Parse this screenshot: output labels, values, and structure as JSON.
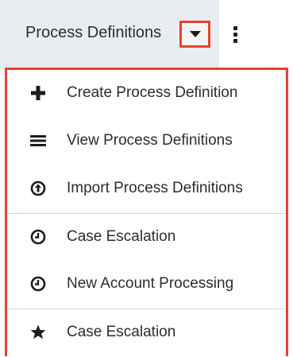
{
  "header": {
    "tab_label": "Process Definitions",
    "caret_icon": "caret-down-icon",
    "more_icon": "vertical-ellipsis-icon"
  },
  "dropdown": {
    "items": [
      {
        "label": "Create Process Definition",
        "icon": "plus-icon"
      },
      {
        "label": "View Process Definitions",
        "icon": "list-icon"
      },
      {
        "label": "Import Process Definitions",
        "icon": "upload-circle-icon"
      },
      {
        "label": "Case Escalation",
        "icon": "clock-icon"
      },
      {
        "label": "New Account Processing",
        "icon": "clock-icon"
      },
      {
        "label": "Case Escalation",
        "icon": "star-icon"
      }
    ]
  },
  "colors": {
    "highlight": "#e8412c",
    "header_bg": "#e9edf2",
    "text": "#2b2d2f",
    "separator": "#d6d6d6"
  }
}
